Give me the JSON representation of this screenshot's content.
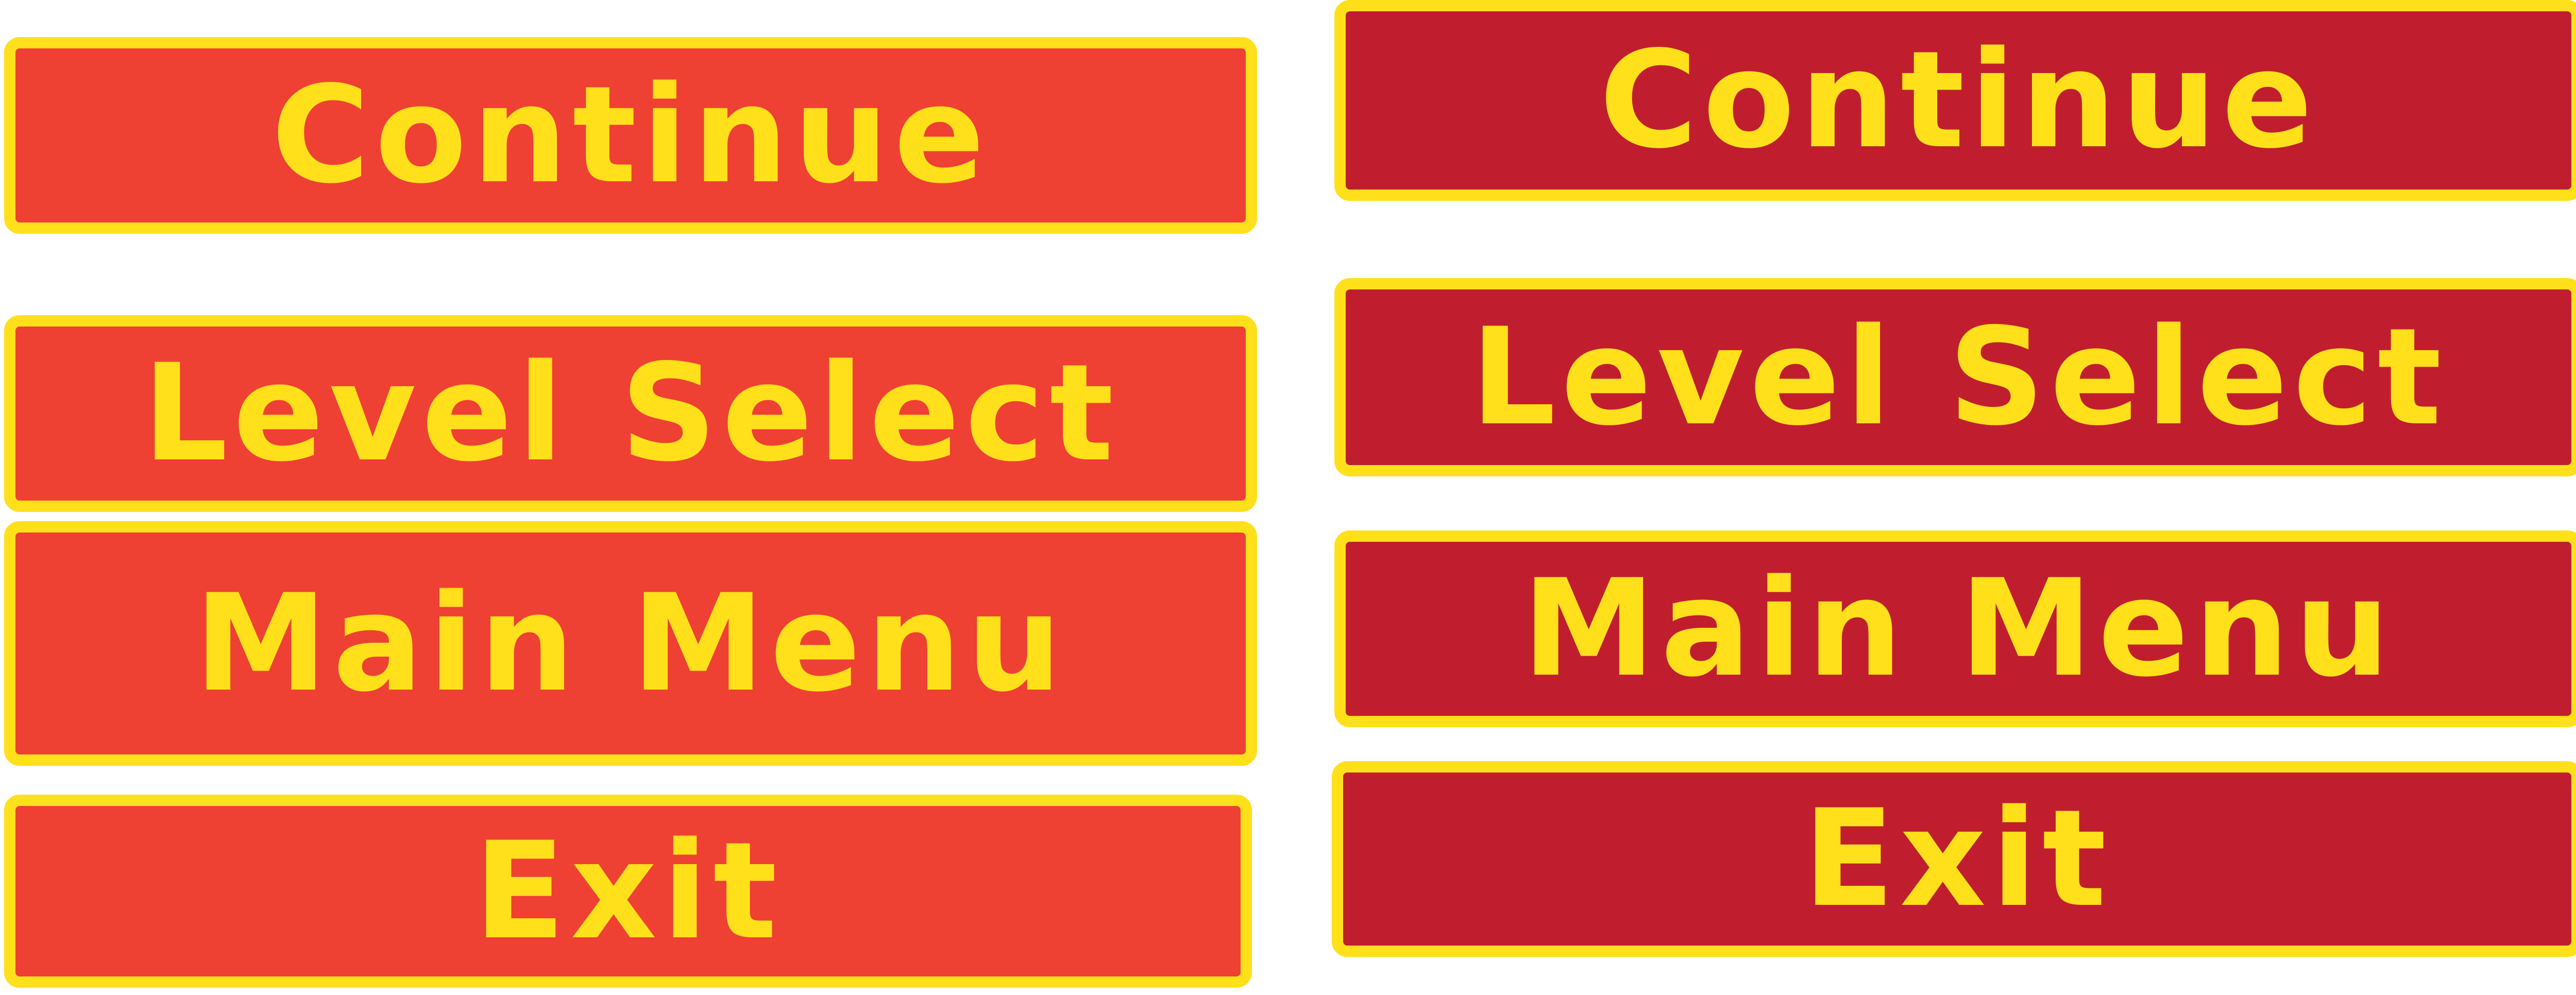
{
  "colors": {
    "background": "#FFFFFF",
    "button_fill_normal": "#EF4034",
    "button_fill_hover": "#C01E2E",
    "button_border": "#FFE01B",
    "button_text": "#FFE01B"
  },
  "menu": {
    "normal": {
      "items": [
        {
          "label": "Continue"
        },
        {
          "label": "Level Select"
        },
        {
          "label": "Main Menu"
        },
        {
          "label": "Exit"
        }
      ]
    },
    "hover": {
      "items": [
        {
          "label": "Continue"
        },
        {
          "label": "Level Select"
        },
        {
          "label": "Main Menu"
        },
        {
          "label": "Exit"
        }
      ]
    }
  }
}
